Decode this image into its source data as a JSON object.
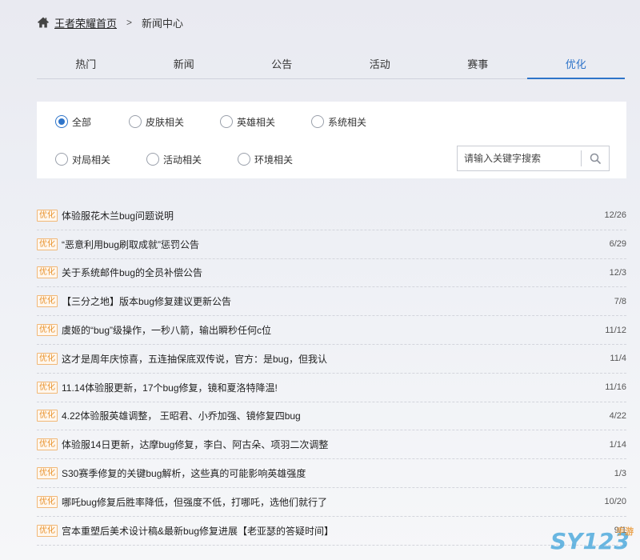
{
  "breadcrumb": {
    "home_label": "王者荣耀首页",
    "separator": ">",
    "current": "新闻中心"
  },
  "tabs": [
    {
      "label": "热门",
      "active": false
    },
    {
      "label": "新闻",
      "active": false
    },
    {
      "label": "公告",
      "active": false
    },
    {
      "label": "活动",
      "active": false
    },
    {
      "label": "赛事",
      "active": false
    },
    {
      "label": "优化",
      "active": true
    }
  ],
  "filters": [
    {
      "label": "全部",
      "checked": true
    },
    {
      "label": "皮肤相关",
      "checked": false
    },
    {
      "label": "英雄相关",
      "checked": false
    },
    {
      "label": "系统相关",
      "checked": false
    },
    {
      "label": "对局相关",
      "checked": false
    },
    {
      "label": "活动相关",
      "checked": false
    },
    {
      "label": "环境相关",
      "checked": false
    }
  ],
  "search": {
    "placeholder": "请输入关键字搜索",
    "value": ""
  },
  "news": [
    {
      "badge": "优化",
      "title": "体验服花木兰bug问题说明",
      "date": "12/26"
    },
    {
      "badge": "优化",
      "title": "“恶意利用bug刷取成就”惩罚公告",
      "date": "6/29"
    },
    {
      "badge": "优化",
      "title": "关于系统邮件bug的全员补偿公告",
      "date": "12/3"
    },
    {
      "badge": "优化",
      "title": "【三分之地】版本bug修复建议更新公告",
      "date": "7/8"
    },
    {
      "badge": "优化",
      "title": "虞姬的“bug”级操作，一秒八箭，输出瞬秒任何c位",
      "date": "11/12"
    },
    {
      "badge": "优化",
      "title": "这才是周年庆惊喜，五连抽保底双传说，官方：是bug，但我认",
      "date": "11/4"
    },
    {
      "badge": "优化",
      "title": "11.14体验服更新，17个bug修复，镜和夏洛特降温!",
      "date": "11/16"
    },
    {
      "badge": "优化",
      "title": "4.22体验服英雄调整， 王昭君、小乔加强、镜修复四bug",
      "date": "4/22"
    },
    {
      "badge": "优化",
      "title": "体验服14日更新，达摩bug修复，李白、阿古朵、项羽二次调整",
      "date": "1/14"
    },
    {
      "badge": "优化",
      "title": "S30赛季修复的关键bug解析，这些真的可能影响英雄强度",
      "date": "1/3"
    },
    {
      "badge": "优化",
      "title": "哪吒bug修复后胜率降低，但强度不低，打哪吒，选他们就行了",
      "date": "10/20"
    },
    {
      "badge": "优化",
      "title": "宫本重塑后美术设计稿&最新bug修复进展【老亚瑟的答疑时间】",
      "date": "9/1"
    }
  ],
  "colors": {
    "accent": "#2e74c9",
    "badge": "#e8922c",
    "watermark": "#3aa0d8"
  },
  "watermark": {
    "text": "SY123",
    "subtext": "手游"
  }
}
